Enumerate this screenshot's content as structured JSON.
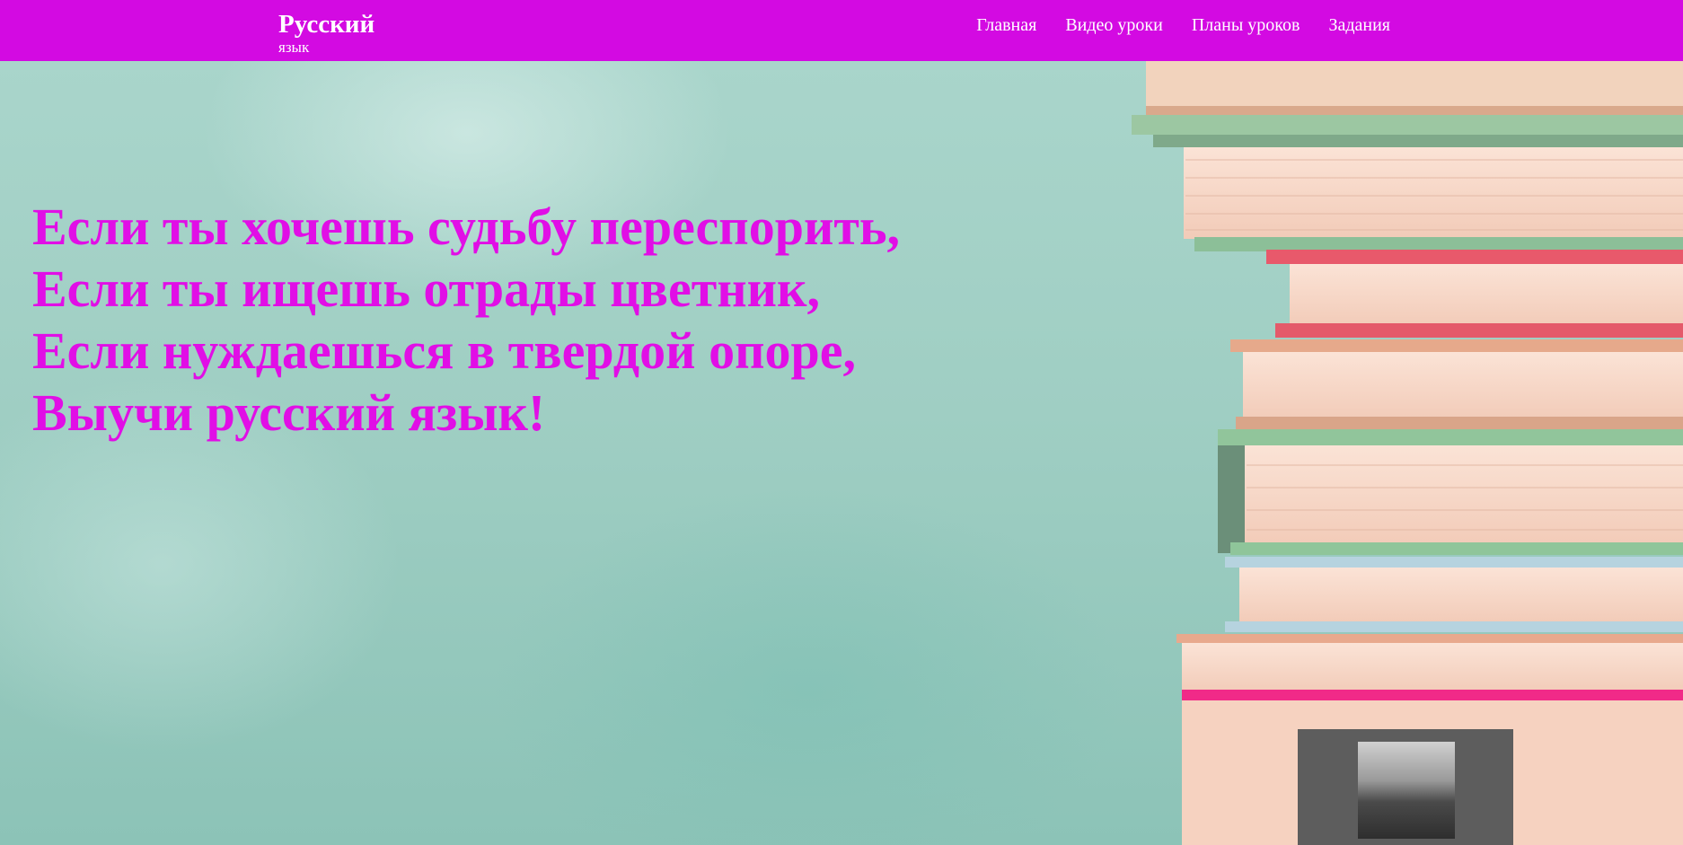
{
  "header": {
    "brand_title": "Русский",
    "brand_subtitle": "язык",
    "nav": [
      {
        "label": "Главная"
      },
      {
        "label": "Видео уроки"
      },
      {
        "label": "Планы уроков"
      },
      {
        "label": "Задания"
      }
    ]
  },
  "hero": {
    "poem_lines": [
      "Если ты хочешь судьбу переспорить,",
      "Если ты ищешь отрады цветник,",
      "Если нуждаешься в твердой опоре,",
      "Выучи русский язык!"
    ]
  },
  "colors": {
    "header_bg": "#d30ae2",
    "poem_text": "#e10ee6",
    "background": "#a6d2c8"
  }
}
